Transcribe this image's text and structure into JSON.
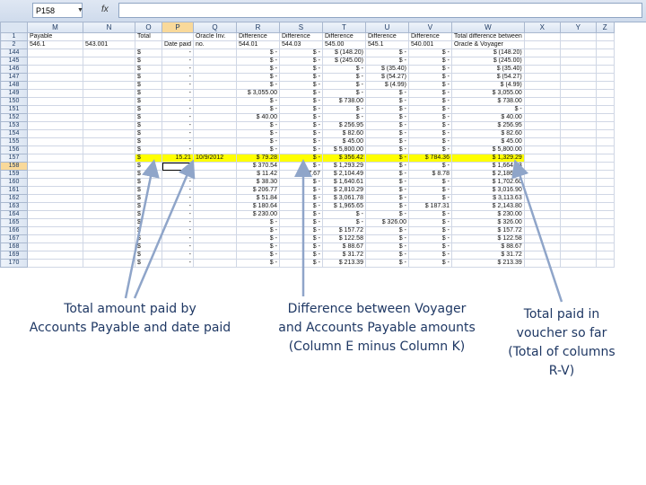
{
  "namebox": {
    "value": "P158"
  },
  "formula_bar": {
    "fx_label": "fx",
    "value": ""
  },
  "columns": [
    "M",
    "N",
    "O",
    "P",
    "Q",
    "R",
    "S",
    "T",
    "U",
    "V",
    "W",
    "X",
    "Y",
    "Z"
  ],
  "selected_column": "P",
  "header_rows": [
    {
      "row": "1",
      "cells": [
        "Payable",
        "",
        "Total",
        "",
        "Oracle Inv.",
        "Difference",
        "Difference",
        "Difference",
        "Difference",
        "Difference",
        "Total difference between",
        "",
        "",
        ""
      ]
    },
    {
      "row": "2",
      "cells": [
        "546.1",
        "543.001",
        "",
        "Date paid",
        "no.",
        "544.01",
        "544.03",
        "545.00",
        "545.1",
        "540.001",
        "Oracle & Voyager",
        "",
        "",
        ""
      ]
    }
  ],
  "data_rows": [
    {
      "row": "144",
      "cells": [
        "",
        "",
        "$",
        "-",
        "",
        "$  -",
        "$  -",
        "$  (148.20)",
        "$  -",
        "$  -",
        "$  (148.20)",
        "",
        "",
        ""
      ]
    },
    {
      "row": "145",
      "cells": [
        "",
        "",
        "$",
        "-",
        "",
        "$  -",
        "$  -",
        "$  (245.00)",
        "$  -",
        "$  -",
        "$  (245.00)",
        "",
        "",
        ""
      ]
    },
    {
      "row": "146",
      "cells": [
        "",
        "",
        "$",
        "-",
        "",
        "$  -",
        "$  -",
        "$  -",
        "$  (35.40)",
        "$  -",
        "$  (35.40)",
        "",
        "",
        ""
      ]
    },
    {
      "row": "147",
      "cells": [
        "",
        "",
        "$",
        "-",
        "",
        "$  -",
        "$  -",
        "$  -",
        "$  (54.27)",
        "$  -",
        "$  (54.27)",
        "",
        "",
        ""
      ]
    },
    {
      "row": "148",
      "cells": [
        "",
        "",
        "$",
        "-",
        "",
        "$  -",
        "$  -",
        "$  -",
        "$  (4.99)",
        "$  -",
        "$  (4.99)",
        "",
        "",
        ""
      ]
    },
    {
      "row": "149",
      "cells": [
        "",
        "",
        "$",
        "-",
        "",
        "$  3,055.00",
        "$  -",
        "$  -",
        "$  -",
        "$  -",
        "$  3,055.00",
        "",
        "",
        ""
      ]
    },
    {
      "row": "150",
      "cells": [
        "",
        "",
        "$",
        "-",
        "",
        "$  -",
        "$  -",
        "$  738.00",
        "$  -",
        "$  -",
        "$  738.00",
        "",
        "",
        ""
      ]
    },
    {
      "row": "151",
      "cells": [
        "",
        "",
        "$",
        "-",
        "",
        "$  -",
        "$  -",
        "$  -",
        "$  -",
        "$  -",
        "$  -",
        "",
        "",
        ""
      ]
    },
    {
      "row": "152",
      "cells": [
        "",
        "",
        "$",
        "-",
        "",
        "$  40.00",
        "$  -",
        "$  -",
        "$  -",
        "$  -",
        "$  40.00",
        "",
        "",
        ""
      ]
    },
    {
      "row": "153",
      "cells": [
        "",
        "",
        "$",
        "-",
        "",
        "$  -",
        "$  -",
        "$  256.95",
        "$  -",
        "$  -",
        "$  256.95",
        "",
        "",
        ""
      ]
    },
    {
      "row": "154",
      "cells": [
        "",
        "",
        "$",
        "-",
        "",
        "$  -",
        "$  -",
        "$  82.60",
        "$  -",
        "$  -",
        "$  82.60",
        "",
        "",
        ""
      ]
    },
    {
      "row": "155",
      "cells": [
        "",
        "",
        "$",
        "-",
        "",
        "$  -",
        "$  -",
        "$  45.00",
        "$  -",
        "$  -",
        "$  45.00",
        "",
        "",
        ""
      ]
    },
    {
      "row": "156",
      "cells": [
        "",
        "",
        "$",
        "-",
        "",
        "$  -",
        "$  -",
        "$  5,800.00",
        "$  -",
        "$  -",
        "$  5,800.00",
        "",
        "",
        ""
      ]
    },
    {
      "row": "157",
      "cells": [
        "",
        "",
        "$",
        "15.21",
        "10/9/2012",
        "$  79.28",
        "$  -",
        "$  356.42",
        "$  -",
        "$  784.36",
        "$  1,329.29",
        "",
        "",
        ""
      ],
      "highlight": [
        2,
        3,
        4,
        5,
        6,
        7,
        8,
        9,
        10
      ]
    },
    {
      "row": "158",
      "cells": [
        "",
        "",
        "$",
        "-",
        "",
        "$  370.54",
        "$  -",
        "$  1,293.29",
        "$  -",
        "$  -",
        "$  1,664.83",
        "",
        "",
        ""
      ]
    },
    {
      "row": "159",
      "cells": [
        "",
        "",
        "$",
        "-",
        "",
        "$  11.42",
        "$  7.67",
        "$  2,104.49",
        "$  -",
        "$  8.78",
        "$  2,186.96",
        "",
        "",
        ""
      ]
    },
    {
      "row": "160",
      "cells": [
        "",
        "",
        "$",
        "-",
        "",
        "$  38.30",
        "$  -",
        "$  1,640.61",
        "$  -",
        "$  -",
        "$  1,702.60",
        "",
        "",
        ""
      ]
    },
    {
      "row": "161",
      "cells": [
        "",
        "",
        "$",
        "-",
        "",
        "$  206.77",
        "$  -",
        "$  2,810.29",
        "$  -",
        "$  -",
        "$  3,016.90",
        "",
        "",
        ""
      ]
    },
    {
      "row": "162",
      "cells": [
        "",
        "",
        "$",
        "-",
        "",
        "$  51.84",
        "$  -",
        "$  3,061.78",
        "$  -",
        "$  -",
        "$  3,113.63",
        "",
        "",
        ""
      ]
    },
    {
      "row": "163",
      "cells": [
        "",
        "",
        "$",
        "-",
        "",
        "$  180.64",
        "$  -",
        "$  1,965.65",
        "$  -",
        "$  187.31",
        "$  2,143.80",
        "",
        "",
        ""
      ]
    },
    {
      "row": "164",
      "cells": [
        "",
        "",
        "$",
        "-",
        "",
        "$  230.00",
        "$  -",
        "$  -",
        "$  -",
        "$  -",
        "$  230.00",
        "",
        "",
        ""
      ]
    },
    {
      "row": "165",
      "cells": [
        "",
        "",
        "$",
        "-",
        "",
        "$  -",
        "$  -",
        "$  -",
        "$  326.00",
        "$  -",
        "$  326.00",
        "",
        "",
        ""
      ]
    },
    {
      "row": "166",
      "cells": [
        "",
        "",
        "$",
        "-",
        "",
        "$  -",
        "$  -",
        "$  157.72",
        "$  -",
        "$  -",
        "$  157.72",
        "",
        "",
        ""
      ]
    },
    {
      "row": "167",
      "cells": [
        "",
        "",
        "$",
        "-",
        "",
        "$  -",
        "$  -",
        "$  122.58",
        "$  -",
        "$  -",
        "$  122.58",
        "",
        "",
        ""
      ]
    },
    {
      "row": "168",
      "cells": [
        "",
        "",
        "$",
        "-",
        "",
        "$  -",
        "$  -",
        "$  88.67",
        "$  -",
        "$  -",
        "$  88.67",
        "",
        "",
        ""
      ]
    },
    {
      "row": "169",
      "cells": [
        "",
        "",
        "$",
        "-",
        "",
        "$  -",
        "$  -",
        "$  31.72",
        "$  -",
        "$  -",
        "$  31.72",
        "",
        "",
        ""
      ]
    },
    {
      "row": "170",
      "cells": [
        "",
        "",
        "$",
        "-",
        "",
        "$  -",
        "$  -",
        "$  213.39",
        "$  -",
        "$  -",
        "$  213.39",
        "",
        "",
        ""
      ]
    }
  ],
  "selected_row": "158",
  "annotations": [
    {
      "id": "paid",
      "text": "Total amount paid by\nAccounts Payable and date paid"
    },
    {
      "id": "diff",
      "text": "Difference between Voyager\nand Accounts Payable amounts\n(Column E minus Column K)"
    },
    {
      "id": "voucher",
      "text": "Total paid in\nvoucher so far\n(Total of columns\nR-V)"
    }
  ],
  "colors": {
    "highlight": "#ffff00",
    "arrow": "#8fa5c9",
    "caption": "#1f3864"
  }
}
